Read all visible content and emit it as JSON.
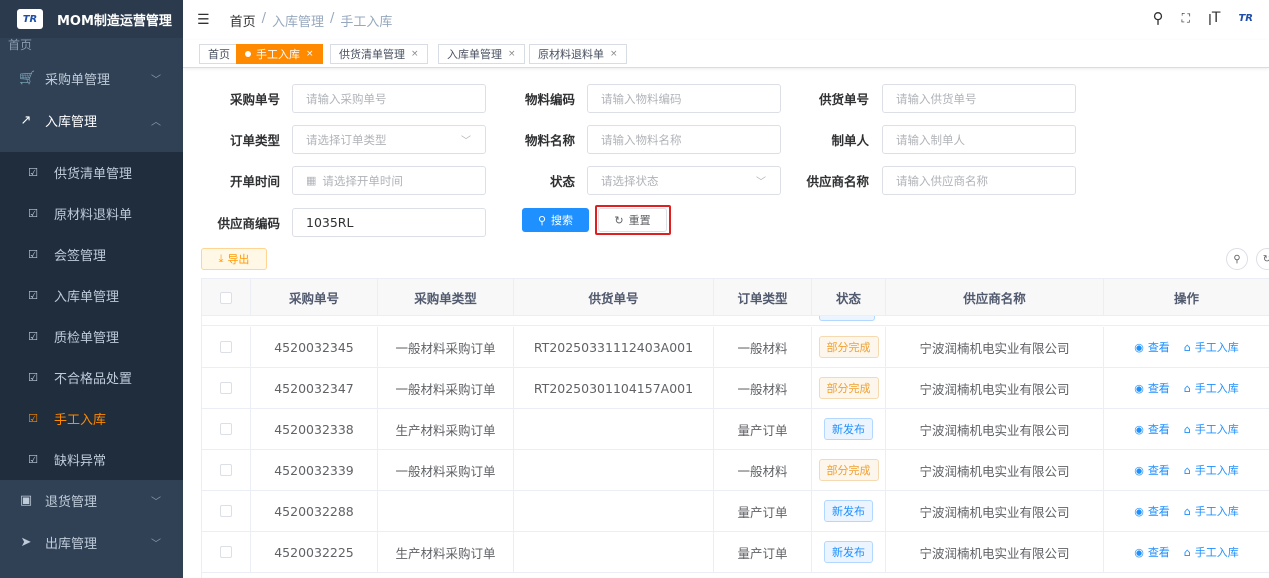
{
  "app": {
    "title": "MOM制造运营管理",
    "logo_text": "TR"
  },
  "sidebar": {
    "clipped_item": "首页",
    "items": [
      {
        "label": "采购单管理",
        "icon": "cart-icon",
        "glyph": "🛒",
        "expandable": true
      },
      {
        "label": "入库管理",
        "icon": "inbound-icon",
        "glyph": "↗",
        "expandable": true,
        "open": true
      },
      {
        "label": "供货清单管理",
        "icon": "checkbox-icon",
        "glyph": "☑",
        "sub": true
      },
      {
        "label": "原材料退料单",
        "icon": "checkbox-icon",
        "glyph": "☑",
        "sub": true
      },
      {
        "label": "会签管理",
        "icon": "checkbox-icon",
        "glyph": "☑",
        "sub": true
      },
      {
        "label": "入库单管理",
        "icon": "checkbox-icon",
        "glyph": "☑",
        "sub": true
      },
      {
        "label": "质检单管理",
        "icon": "checkbox-icon",
        "glyph": "☑",
        "sub": true
      },
      {
        "label": "不合格品处置",
        "icon": "checkbox-icon",
        "glyph": "☑",
        "sub": true
      },
      {
        "label": "手工入库",
        "icon": "checkbox-icon",
        "glyph": "☑",
        "sub": true,
        "active": true
      },
      {
        "label": "缺料异常",
        "icon": "checkbox-icon",
        "glyph": "☑",
        "sub": true
      },
      {
        "label": "退货管理",
        "icon": "return-icon",
        "glyph": "▣",
        "expandable": true
      },
      {
        "label": "出库管理",
        "icon": "send-icon",
        "glyph": "➤",
        "expandable": true
      }
    ]
  },
  "header": {
    "breadcrumb": [
      "首页",
      "/",
      "入库管理",
      "/",
      "手工入库"
    ]
  },
  "tags": [
    {
      "label": "首页",
      "closable": false
    },
    {
      "label": "手工入库",
      "closable": true,
      "active": true
    },
    {
      "label": "供货清单管理",
      "closable": true
    },
    {
      "label": "入库单管理",
      "closable": true
    },
    {
      "label": "原材料退料单",
      "closable": true
    }
  ],
  "form": {
    "purchase_no": {
      "label": "采购单号",
      "placeholder": "请输入采购单号"
    },
    "material_code": {
      "label": "物料编码",
      "placeholder": "请输入物料编码"
    },
    "supply_no": {
      "label": "供货单号",
      "placeholder": "请输入供货单号"
    },
    "order_type": {
      "label": "订单类型",
      "placeholder": "请选择订单类型"
    },
    "material_name": {
      "label": "物料名称",
      "placeholder": "请输入物料名称"
    },
    "creator": {
      "label": "制单人",
      "placeholder": "请输入制单人"
    },
    "open_time": {
      "label": "开单时间",
      "placeholder": "请选择开单时间"
    },
    "status": {
      "label": "状态",
      "placeholder": "请选择状态"
    },
    "supplier_name": {
      "label": "供应商名称",
      "placeholder": "请输入供应商名称"
    },
    "supplier_code": {
      "label": "供应商编码",
      "value": "1035RL"
    },
    "search_label": "搜索",
    "reset_label": "重置"
  },
  "toolbar": {
    "export_label": "导出"
  },
  "table": {
    "columns": [
      "采购单号",
      "采购单类型",
      "供货单号",
      "订单类型",
      "状态",
      "供应商名称",
      "操作"
    ],
    "view_label": "查看",
    "manual_label": "手工入库",
    "rows": [
      {
        "purchase_no": "4520032345",
        "purchase_type": "一般材料采购订单",
        "supply_no": "RT20250331112403A001",
        "order_type": "一般材料",
        "status": "部分完成",
        "status_kind": "warn",
        "supplier": "宁波润楠机电实业有限公司"
      },
      {
        "purchase_no": "4520032347",
        "purchase_type": "一般材料采购订单",
        "supply_no": "RT20250301104157A001",
        "order_type": "一般材料",
        "status": "部分完成",
        "status_kind": "warn",
        "supplier": "宁波润楠机电实业有限公司"
      },
      {
        "purchase_no": "4520032338",
        "purchase_type": "生产材料采购订单",
        "supply_no": "",
        "order_type": "量产订单",
        "status": "新发布",
        "status_kind": "info",
        "supplier": "宁波润楠机电实业有限公司"
      },
      {
        "purchase_no": "4520032339",
        "purchase_type": "一般材料采购订单",
        "supply_no": "",
        "order_type": "一般材料",
        "status": "部分完成",
        "status_kind": "warn",
        "supplier": "宁波润楠机电实业有限公司"
      },
      {
        "purchase_no": "4520032288",
        "purchase_type": "",
        "supply_no": "",
        "order_type": "量产订单",
        "status": "新发布",
        "status_kind": "info",
        "supplier": "宁波润楠机电实业有限公司"
      },
      {
        "purchase_no": "4520032225",
        "purchase_type": "生产材料采购订单",
        "supply_no": "",
        "order_type": "量产订单",
        "status": "新发布",
        "status_kind": "info",
        "supplier": "宁波润楠机电实业有限公司"
      }
    ]
  },
  "colors": {
    "sidebar_bg": "#304156",
    "accent": "#ff8a00",
    "primary": "#1e90ff",
    "highlight": "#e02020"
  }
}
